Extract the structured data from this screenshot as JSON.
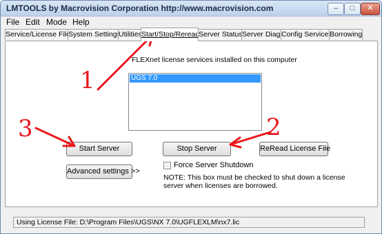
{
  "window": {
    "title": "LMTOOLS by Macrovision Corporation http://www.macrovision.com",
    "min_glyph": "–",
    "max_glyph": "□",
    "close_glyph": "✕"
  },
  "menu": {
    "items": [
      "File",
      "Edit",
      "Mode",
      "Help"
    ]
  },
  "tabs": [
    {
      "label": "Service/License File"
    },
    {
      "label": "System Settings"
    },
    {
      "label": "Utilities"
    },
    {
      "label": "Start/Stop/Reread",
      "active": true
    },
    {
      "label": "Server Status"
    },
    {
      "label": "Server Diags"
    },
    {
      "label": "Config Services"
    },
    {
      "label": "Borrowing"
    }
  ],
  "main": {
    "services_label": "FLEXnet license services installed on this computer",
    "services": [
      {
        "name": "UGS 7.0",
        "selected": true
      }
    ],
    "buttons": {
      "start_server": "Start Server",
      "stop_server": "Stop Server",
      "reread_license": "ReRead License File",
      "advanced_settings": "Advanced settings >>"
    },
    "force_shutdown": {
      "label": "Force Server Shutdown",
      "checked": false
    },
    "note": "NOTE:  This box must be checked to shut down a license server when licenses are borrowed."
  },
  "status": {
    "text": "Using License File:  D:\\Program Files\\UGS\\NX 7.0\\UGFLEXLM\\nx7.lic"
  },
  "annotations": {
    "labels": [
      "1",
      "2",
      "3"
    ],
    "color": "#e8181c"
  }
}
